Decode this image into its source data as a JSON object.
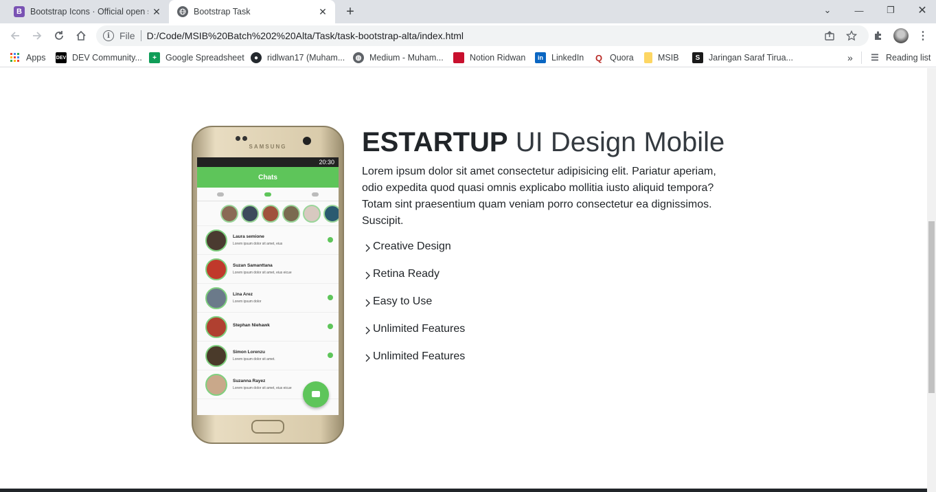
{
  "browser": {
    "tabs": [
      {
        "title": "Bootstrap Icons · Official open so",
        "favicon": "B",
        "favicon_color": "#7952b3",
        "active": false
      },
      {
        "title": "Bootstrap Task",
        "favicon": "globe-icon",
        "active": true
      }
    ],
    "omnibox": {
      "scheme_label": "File",
      "url": "D:/Code/MSIB%20Batch%202%20Alta/Task/task-bootstrap-alta/index.html"
    },
    "bookmarks": [
      {
        "label": "Apps",
        "icon": "apps-grid-icon"
      },
      {
        "label": "DEV Community...",
        "icon": "dev-icon"
      },
      {
        "label": "Google Spreadsheet",
        "icon": "sheets-icon"
      },
      {
        "label": "ridlwan17 (Muham...",
        "icon": "github-icon"
      },
      {
        "label": "Medium - Muham...",
        "icon": "globe-icon"
      },
      {
        "label": "Notion Ridwan",
        "icon": "notion-icon"
      },
      {
        "label": "LinkedIn",
        "icon": "linkedin-icon"
      },
      {
        "label": "Quora",
        "icon": "quora-icon"
      },
      {
        "label": "MSIB",
        "icon": "folder-icon"
      },
      {
        "label": "Jaringan Saraf Tirua...",
        "icon": "scribd-icon"
      }
    ],
    "overflow_label": "»",
    "reading_list_label": "Reading list"
  },
  "content": {
    "heading_bold": "ESTARTUP",
    "heading_light": " UI Design Mobile",
    "description": "Lorem ipsum dolor sit amet consectetur adipisicing elit. Pariatur aperiam, odio expedita quod quasi omnis explicabo mollitia iusto aliquid tempora? Totam sint praesentium quam veniam porro consectetur ea dignissimos. Suscipit.",
    "features": [
      "Creative Design",
      "Retina Ready",
      "Easy to Use",
      "Unlimited Features",
      "Unlimited Features"
    ]
  },
  "phone": {
    "brand": "SAMSUNG",
    "status_time": "20:30",
    "app_title": "Chats",
    "chats": [
      {
        "name": "Laura semione",
        "msg": "Lorem ipsum dolor sit amet, eius"
      },
      {
        "name": "Suzan Samanttana",
        "msg": "Lorem ipsum dolor sit amet, eius eicue"
      },
      {
        "name": "Lina Arez",
        "msg": "Lorem ipsum dolor"
      },
      {
        "name": "Stephan Niehawk",
        "msg": ""
      },
      {
        "name": "Simon Lorenzu",
        "msg": "Lorem ipsum dolor sit amet."
      },
      {
        "name": "Suzanna Rayez",
        "msg": "Lorem ipsum dolor sit amet, eius eicue"
      }
    ]
  },
  "colors": {
    "accent_green": "#5ec55a",
    "text": "#212529"
  }
}
